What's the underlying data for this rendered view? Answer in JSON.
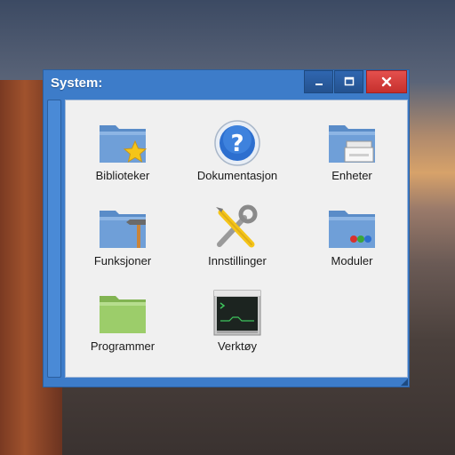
{
  "window": {
    "title": "System:",
    "minimize_icon": "minimize-icon",
    "maximize_icon": "maximize-icon",
    "close_icon": "close-icon"
  },
  "colors": {
    "window_frame": "#3d7cc9",
    "content_bg": "#f0f0f0",
    "close_button": "#d9403d",
    "folder_blue": "#6f9fd8",
    "folder_green": "#9ccd6a"
  },
  "items": [
    {
      "label": "Biblioteker",
      "icon": "folder-star-icon"
    },
    {
      "label": "Dokumentasjon",
      "icon": "help-icon"
    },
    {
      "label": "Enheter",
      "icon": "folder-printer-icon"
    },
    {
      "label": "Funksjoner",
      "icon": "folder-hammer-icon"
    },
    {
      "label": "Innstillinger",
      "icon": "tools-icon"
    },
    {
      "label": "Moduler",
      "icon": "folder-modules-icon"
    },
    {
      "label": "Programmer",
      "icon": "folder-green-icon"
    },
    {
      "label": "Verktøy",
      "icon": "terminal-icon"
    }
  ]
}
